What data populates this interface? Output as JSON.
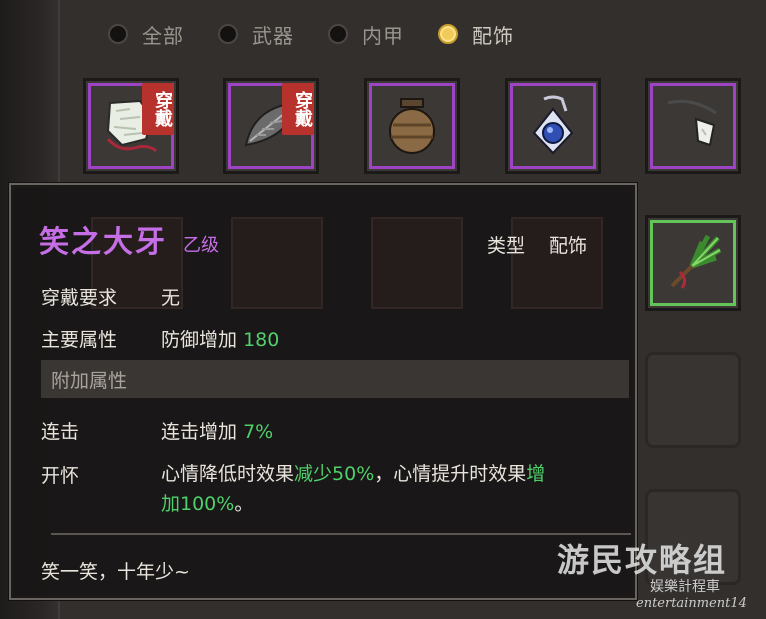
{
  "tabs": [
    {
      "label": "全部",
      "active": false
    },
    {
      "label": "武器",
      "active": false
    },
    {
      "label": "内甲",
      "active": false
    },
    {
      "label": "配饰",
      "active": true
    }
  ],
  "slots": [
    {
      "icon": "white-fur-tassel-icon",
      "worn_tag": "穿戴",
      "rarity_color": "#9c44c4"
    },
    {
      "icon": "grey-leaf-blade-icon",
      "worn_tag": "穿戴",
      "rarity_color": "#9c44c4"
    },
    {
      "icon": "clay-jar-icon",
      "worn_tag": "",
      "rarity_color": "#9c44c4"
    },
    {
      "icon": "blue-gem-amulet-icon",
      "worn_tag": "",
      "rarity_color": "#9c44c4"
    },
    {
      "icon": "tooth-necklace-icon",
      "worn_tag": "",
      "rarity_color": "#9c44c4"
    },
    {
      "icon": "green-herb-bundle-icon",
      "worn_tag": "",
      "rarity_color": "#63c45a"
    }
  ],
  "tooltip": {
    "title": "笑之大牙",
    "grade": "乙级",
    "type_label": "类型",
    "type_value": "配饰",
    "requirement_label": "穿戴要求",
    "requirement_value": "无",
    "main_attr_label": "主要属性",
    "main_attr_text": "防御增加",
    "main_attr_value": "180",
    "extra_section": "附加属性",
    "combo_label": "连击",
    "combo_text": "连击增加",
    "combo_value": "7%",
    "cheer_label": "开怀",
    "cheer_text_1": "心情降低时效果",
    "cheer_value_1": "减少50%",
    "cheer_text_2": "，心情提升时效果",
    "cheer_value_2a": "增",
    "cheer_value_2b": "加100%",
    "cheer_text_3": "。",
    "flavor": "笑一笑，十年少~"
  },
  "watermark": {
    "main": "游民攻略组",
    "sub": "娱樂計程車",
    "en": "entertainment14"
  },
  "colors": {
    "accent_purple": "#c56ee6",
    "value_green": "#4fd06a",
    "active_radio": "#f1cb5a",
    "worn_tag": "#b7322c"
  }
}
